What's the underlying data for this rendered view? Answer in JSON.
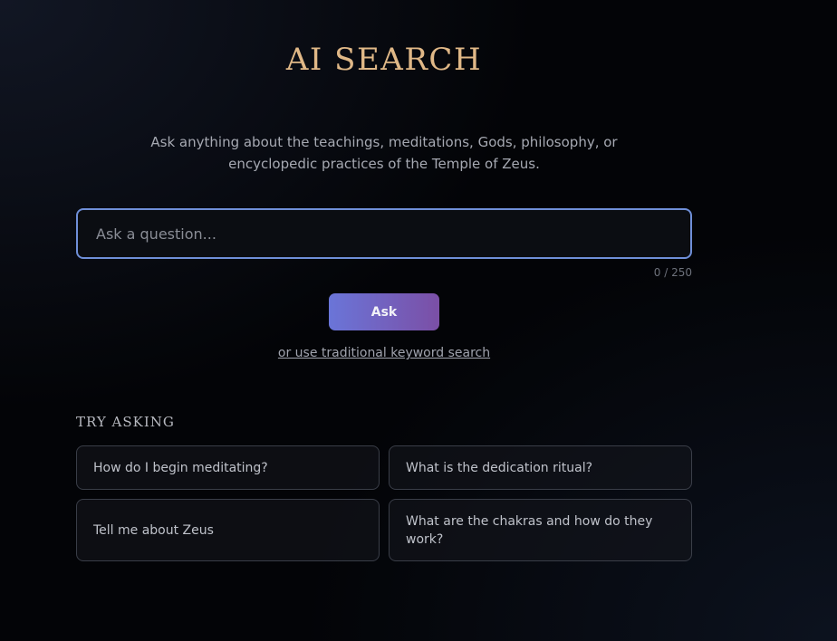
{
  "header": {
    "title": "AI SEARCH",
    "subtitle": "Ask anything about the teachings, meditations, Gods, philosophy, or encyclopedic practices of the Temple of Zeus."
  },
  "search": {
    "placeholder": "Ask a question...",
    "value": "",
    "counter": "0 / 250",
    "ask_label": "Ask",
    "keyword_link": "or use traditional keyword search"
  },
  "suggestions": {
    "heading": "TRY ASKING",
    "items": [
      {
        "label": "How do I begin meditating?"
      },
      {
        "label": "What is the dedication ritual?"
      },
      {
        "label": "Tell me about Zeus"
      },
      {
        "label": "What are the chakras and how do they work?"
      }
    ]
  },
  "colors": {
    "accent_gold": "#e0b887",
    "input_border": "#6f8fd8",
    "button_gradient_start": "#6a75d8",
    "button_gradient_end": "#7b4fa6"
  }
}
